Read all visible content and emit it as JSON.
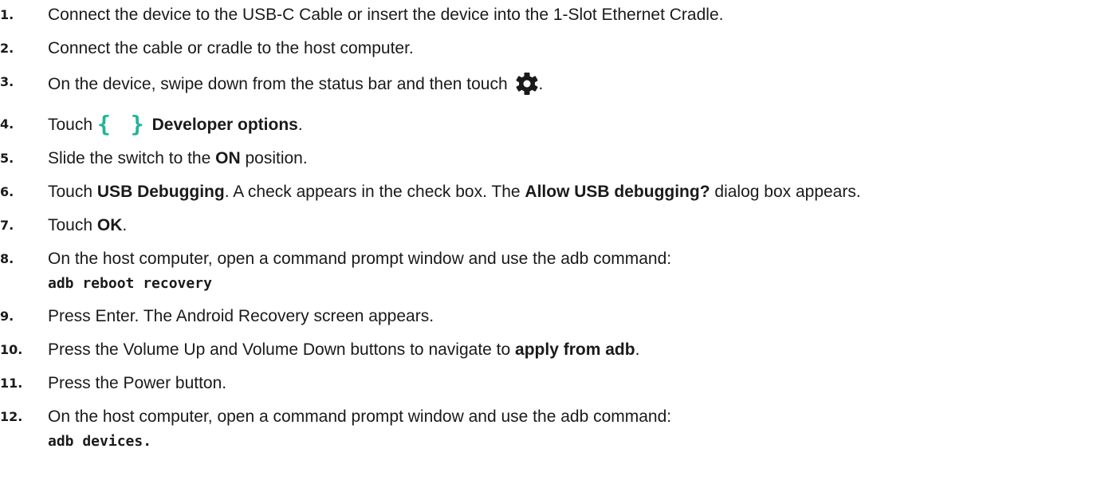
{
  "steps": [
    {
      "num": "1.",
      "text": "Connect the device to the USB-C Cable or insert the device into the 1-Slot Ethernet Cradle."
    },
    {
      "num": "2.",
      "text": "Connect the cable or cradle to the host computer."
    },
    {
      "num": "3.",
      "text": "On the device, swipe down from the status bar and then touch",
      "after": "."
    },
    {
      "num": "4.",
      "text": "Touch",
      "braces": "{ }",
      "bold": "Developer options",
      "after": "."
    },
    {
      "num": "5.",
      "text": "Slide the switch to the",
      "bold": "ON",
      "after": "position."
    },
    {
      "num": "6.",
      "text": "Touch",
      "bold": "USB Debugging",
      "mid": ". A check appears in the check box. The",
      "bold2": "Allow USB debugging?",
      "after": "dialog box appears."
    },
    {
      "num": "7.",
      "text": "Touch",
      "bold": "OK",
      "after": "."
    },
    {
      "num": "8.",
      "text": "On the host computer, open a command prompt window and use the adb command:",
      "code": "adb reboot recovery"
    },
    {
      "num": "9.",
      "text": "Press Enter. The Android Recovery screen appears."
    },
    {
      "num": "10.",
      "text": "Press the Volume Up and Volume Down buttons to navigate to",
      "bold": "apply from adb",
      "after": "."
    },
    {
      "num": "11.",
      "text": "Press the Power button."
    },
    {
      "num": "12.",
      "text": "On the host computer, open a command prompt window and use the adb command:",
      "code": "adb devices."
    }
  ]
}
